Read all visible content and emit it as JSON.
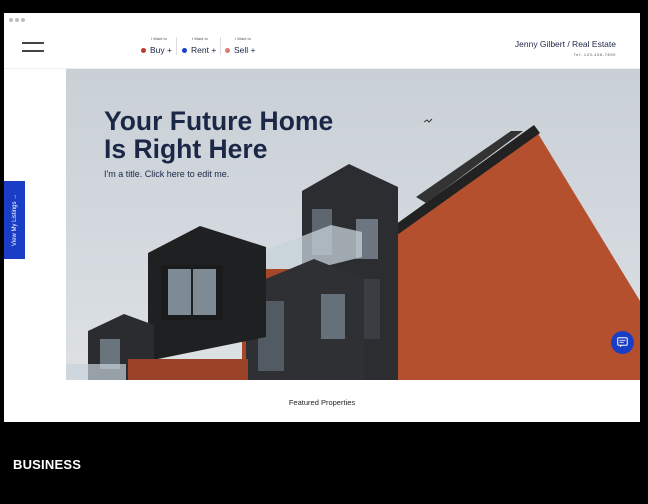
{
  "nav": {
    "menu_icon": "hamburger-icon",
    "items": [
      {
        "prefix": "I Want to",
        "label": "Buy +",
        "color": "#c0392b"
      },
      {
        "prefix": "I Want to",
        "label": "Rent +",
        "color": "#1a3dc6"
      },
      {
        "prefix": "I Want to",
        "label": "Sell +",
        "color": "#e07a6b"
      }
    ],
    "brand": "Jenny Gilbert / Real Estate",
    "tel": "Tel: 123-456-7890"
  },
  "hero": {
    "title_line1": "Your Future Home",
    "title_line2": "Is Right Here",
    "subtitle": "I'm a title. Click here to edit me."
  },
  "side_tab": {
    "label": "View My Listings →"
  },
  "chat": {
    "icon": "chat-icon"
  },
  "featured": {
    "label": "Featured Properties"
  },
  "category": {
    "label": "BUSINESS"
  },
  "colors": {
    "accent": "#1a3dc6",
    "heading": "#1b2747",
    "brick": "#b5502e"
  }
}
